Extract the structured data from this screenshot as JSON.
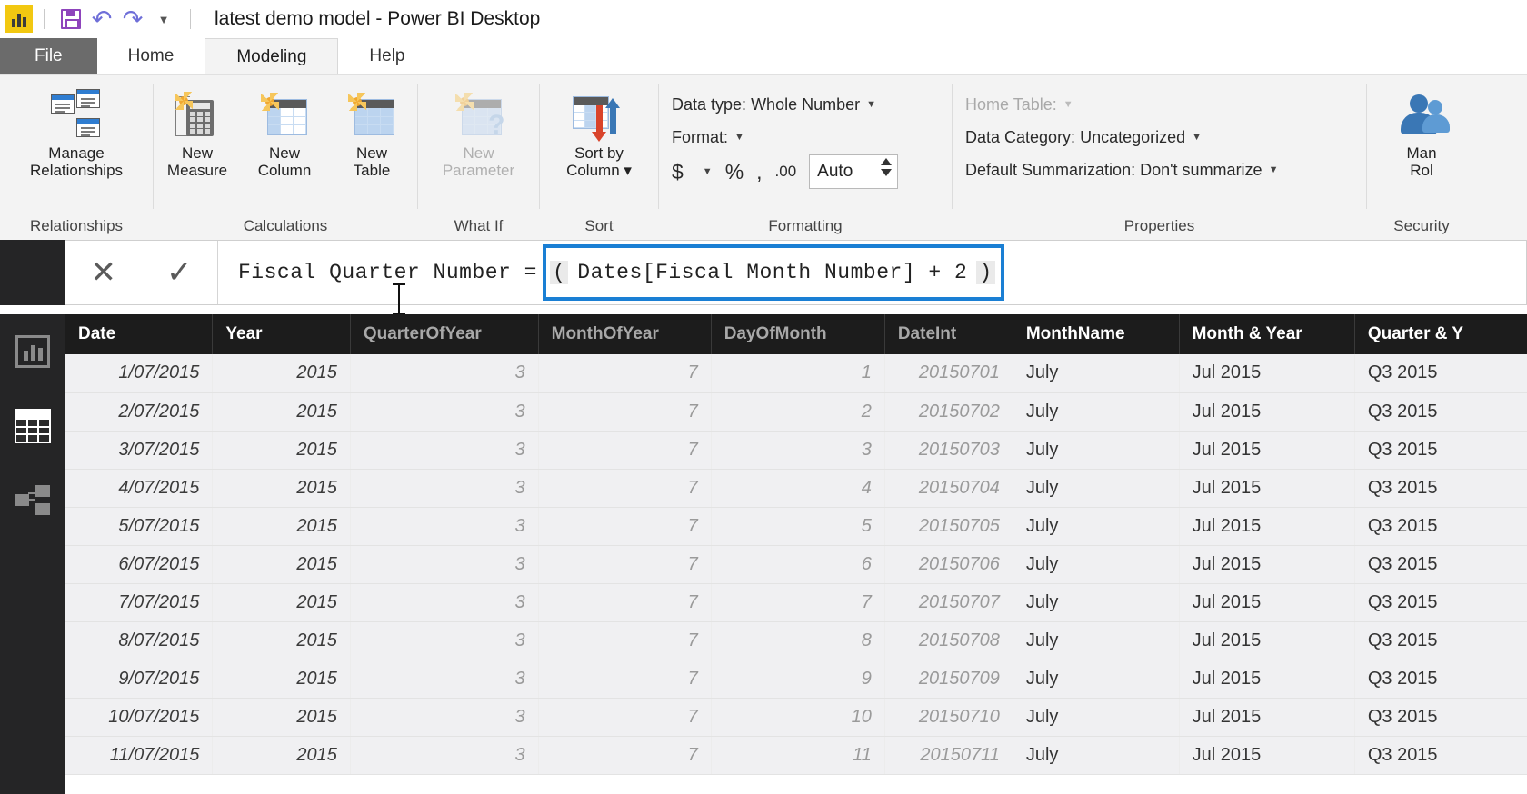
{
  "titlebar": {
    "document_title": "latest demo model - Power BI Desktop",
    "icons": {
      "app": "power-bi-logo",
      "save": "save-icon",
      "undo": "undo-icon",
      "redo": "redo-icon",
      "customize": "customize-quick-access-caret"
    }
  },
  "tabs": [
    {
      "label": "File",
      "state": "file"
    },
    {
      "label": "Home",
      "state": "normal"
    },
    {
      "label": "Modeling",
      "state": "active"
    },
    {
      "label": "Help",
      "state": "normal"
    }
  ],
  "ribbon": {
    "groups": [
      {
        "name": "Relationships",
        "label": "Relationships",
        "buttons": [
          {
            "label_line1": "Manage",
            "label_line2": "Relationships",
            "icon": "manage-relationships-icon",
            "disabled": false
          }
        ]
      },
      {
        "name": "Calculations",
        "label": "Calculations",
        "buttons": [
          {
            "label_line1": "New",
            "label_line2": "Measure",
            "icon": "new-measure-icon",
            "disabled": false
          },
          {
            "label_line1": "New",
            "label_line2": "Column",
            "icon": "new-column-icon",
            "disabled": false
          },
          {
            "label_line1": "New",
            "label_line2": "Table",
            "icon": "new-table-icon",
            "disabled": false
          }
        ]
      },
      {
        "name": "What If",
        "label": "What If",
        "buttons": [
          {
            "label_line1": "New",
            "label_line2": "Parameter",
            "icon": "new-parameter-icon",
            "disabled": true
          }
        ]
      },
      {
        "name": "Sort",
        "label": "Sort",
        "buttons": [
          {
            "label_line1": "Sort by",
            "label_line2": "Column ▾",
            "icon": "sort-by-column-icon",
            "disabled": false
          }
        ]
      }
    ],
    "formatting": {
      "label": "Formatting",
      "data_type_label": "Data type:",
      "data_type_value": "Whole Number",
      "format_label": "Format:",
      "format_value": "",
      "currency_symbol": "$",
      "percent_symbol": "%",
      "thousands_symbol": ",",
      "decimal_symbol": ".00",
      "decimal_places_value": "Auto"
    },
    "properties": {
      "label": "Properties",
      "home_table_label": "Home Table:",
      "home_table_value": "",
      "data_category_label": "Data Category:",
      "data_category_value": "Uncategorized",
      "default_summarization_label": "Default Summarization:",
      "default_summarization_value": "Don't summarize"
    },
    "security": {
      "label": "Security",
      "manage_roles_line1": "Man",
      "manage_roles_line2": "Rol"
    }
  },
  "formula_bar": {
    "cancel_icon": "cancel-x-icon",
    "accept_icon": "accept-check-icon",
    "prefix": "Fiscal Quarter Number = ",
    "open_paren": "(",
    "expression": "Dates[Fiscal Month Number] + 2",
    "close_paren": ")",
    "highlight_color": "#1a7fd4"
  },
  "view_rail": {
    "items": [
      {
        "name": "report-view",
        "icon": "report-view-icon",
        "active": false
      },
      {
        "name": "data-view",
        "icon": "data-view-icon",
        "active": true
      },
      {
        "name": "model-view",
        "icon": "model-view-icon",
        "active": false
      }
    ]
  },
  "grid": {
    "columns": [
      {
        "key": "date",
        "header": "Date",
        "style": "bold",
        "cls": "c-date",
        "cellcls": "italic"
      },
      {
        "key": "year",
        "header": "Year",
        "style": "bold",
        "cls": "c-year",
        "cellcls": "italic"
      },
      {
        "key": "qoy",
        "header": "QuarterOfYear",
        "style": "gray",
        "cls": "c-qoy",
        "cellcls": "gray"
      },
      {
        "key": "moy",
        "header": "MonthOfYear",
        "style": "gray",
        "cls": "c-moy",
        "cellcls": "gray"
      },
      {
        "key": "dom",
        "header": "DayOfMonth",
        "style": "gray",
        "cls": "c-dom",
        "cellcls": "gray"
      },
      {
        "key": "dateint",
        "header": "DateInt",
        "style": "gray",
        "cls": "c-dint",
        "cellcls": "gray"
      },
      {
        "key": "monthname",
        "header": "MonthName",
        "style": "bold",
        "cls": "c-mname",
        "cellcls": "plain"
      },
      {
        "key": "monthyear",
        "header": "Month & Year",
        "style": "bold",
        "cls": "c-myear",
        "cellcls": "plain"
      },
      {
        "key": "quarteryear",
        "header": "Quarter & Y",
        "style": "bold",
        "cls": "c-qyear",
        "cellcls": "plain"
      }
    ],
    "rows": [
      {
        "date": "1/07/2015",
        "year": "2015",
        "qoy": "3",
        "moy": "7",
        "dom": "1",
        "dateint": "20150701",
        "monthname": "July",
        "monthyear": "Jul 2015",
        "quarteryear": "Q3 2015"
      },
      {
        "date": "2/07/2015",
        "year": "2015",
        "qoy": "3",
        "moy": "7",
        "dom": "2",
        "dateint": "20150702",
        "monthname": "July",
        "monthyear": "Jul 2015",
        "quarteryear": "Q3 2015"
      },
      {
        "date": "3/07/2015",
        "year": "2015",
        "qoy": "3",
        "moy": "7",
        "dom": "3",
        "dateint": "20150703",
        "monthname": "July",
        "monthyear": "Jul 2015",
        "quarteryear": "Q3 2015"
      },
      {
        "date": "4/07/2015",
        "year": "2015",
        "qoy": "3",
        "moy": "7",
        "dom": "4",
        "dateint": "20150704",
        "monthname": "July",
        "monthyear": "Jul 2015",
        "quarteryear": "Q3 2015"
      },
      {
        "date": "5/07/2015",
        "year": "2015",
        "qoy": "3",
        "moy": "7",
        "dom": "5",
        "dateint": "20150705",
        "monthname": "July",
        "monthyear": "Jul 2015",
        "quarteryear": "Q3 2015"
      },
      {
        "date": "6/07/2015",
        "year": "2015",
        "qoy": "3",
        "moy": "7",
        "dom": "6",
        "dateint": "20150706",
        "monthname": "July",
        "monthyear": "Jul 2015",
        "quarteryear": "Q3 2015"
      },
      {
        "date": "7/07/2015",
        "year": "2015",
        "qoy": "3",
        "moy": "7",
        "dom": "7",
        "dateint": "20150707",
        "monthname": "July",
        "monthyear": "Jul 2015",
        "quarteryear": "Q3 2015"
      },
      {
        "date": "8/07/2015",
        "year": "2015",
        "qoy": "3",
        "moy": "7",
        "dom": "8",
        "dateint": "20150708",
        "monthname": "July",
        "monthyear": "Jul 2015",
        "quarteryear": "Q3 2015"
      },
      {
        "date": "9/07/2015",
        "year": "2015",
        "qoy": "3",
        "moy": "7",
        "dom": "9",
        "dateint": "20150709",
        "monthname": "July",
        "monthyear": "Jul 2015",
        "quarteryear": "Q3 2015"
      },
      {
        "date": "10/07/2015",
        "year": "2015",
        "qoy": "3",
        "moy": "7",
        "dom": "10",
        "dateint": "20150710",
        "monthname": "July",
        "monthyear": "Jul 2015",
        "quarteryear": "Q3 2015"
      },
      {
        "date": "11/07/2015",
        "year": "2015",
        "qoy": "3",
        "moy": "7",
        "dom": "11",
        "dateint": "20150711",
        "monthname": "July",
        "monthyear": "Jul 2015",
        "quarteryear": "Q3 2015"
      }
    ]
  }
}
